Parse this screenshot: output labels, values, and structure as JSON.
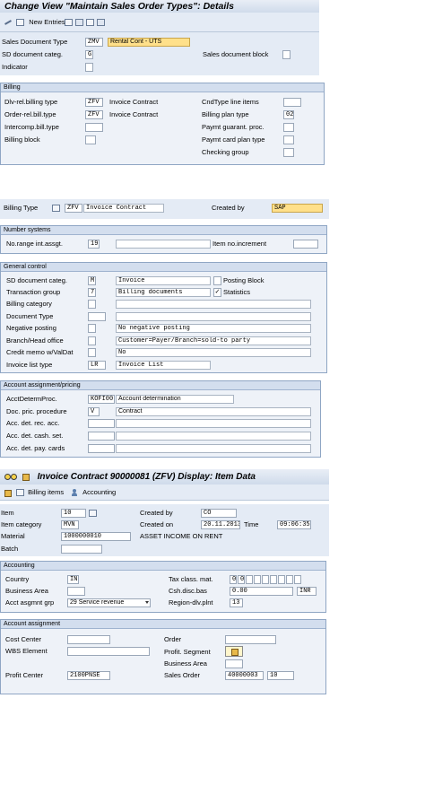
{
  "s1": {
    "title": "Change View \"Maintain Sales Order Types\": Details",
    "new_entries": "New Entries",
    "rows": [
      {
        "label": "Sales Document Type",
        "code": "ZMV",
        "desc": "Rental Cont - UTS"
      },
      {
        "label": "SD document categ.",
        "code": "G"
      },
      {
        "label": "Indicator"
      }
    ],
    "sales_doc_block_label": "Sales document block",
    "billing_title": "Billing",
    "billing_left": [
      {
        "label": "Dlv-rel.billing type",
        "code": "ZFV",
        "desc": "Invoice Contract"
      },
      {
        "label": "Order-rel.bill.type",
        "code": "ZFV",
        "desc": "Invoice Contract"
      },
      {
        "label": "Intercomp.bill.type"
      },
      {
        "label": "Billing block"
      }
    ],
    "billing_right": [
      {
        "label": "CndType line items",
        "value": ""
      },
      {
        "label": "Billing plan type",
        "value": "02"
      },
      {
        "label": "Paymt guarant. proc.",
        "value": ""
      },
      {
        "label": "Paymt card plan type",
        "value": ""
      },
      {
        "label": "Checking group",
        "value": ""
      }
    ]
  },
  "s2": {
    "billing_type_label": "Billing Type",
    "billing_type_code": "ZFV",
    "billing_type_desc": "Invoice Contract",
    "created_by_label": "Created by",
    "created_by_value": "SAP",
    "number_systems_title": "Number systems",
    "no_range_label": "No.range int.assgt.",
    "no_range_value": "19",
    "item_no_incr_label": "Item no.increment",
    "general_title": "General control",
    "general": [
      {
        "label": "SD document categ.",
        "code": "M",
        "desc": "Invoice"
      },
      {
        "label": "Transaction group",
        "code": "7",
        "desc": "Billing documents"
      },
      {
        "label": "Billing category",
        "code": "",
        "desc": ""
      },
      {
        "label": "Document Type",
        "code": "",
        "desc": ""
      },
      {
        "label": "Negative posting",
        "code": "",
        "desc": "No negative posting"
      },
      {
        "label": "Branch/Head office",
        "code": "",
        "desc": "Customer=Payer/Branch=sold-to party"
      },
      {
        "label": "Credit memo w/ValDat",
        "code": "",
        "desc": "No"
      },
      {
        "label": "Invoice list type",
        "code": "LR",
        "desc": "Invoice List"
      }
    ],
    "posting_block_label": "Posting Block",
    "statistics_label": "Statistics",
    "acct_title": "Account assignment/pricing",
    "acct": [
      {
        "label": "AcctDetermProc.",
        "code": "KOFI00",
        "desc": "Account determination"
      },
      {
        "label": "Doc. pric. procedure",
        "code": "V",
        "desc": "Contract"
      },
      {
        "label": "Acc. det. rec. acc.",
        "code": "",
        "desc": ""
      },
      {
        "label": "Acc. det. cash. set.",
        "code": "",
        "desc": ""
      },
      {
        "label": "Acc. det. pay. cards",
        "code": "",
        "desc": ""
      }
    ]
  },
  "s3": {
    "title": "Invoice Contract 90000081  (ZFV) Display: Item Data",
    "billing_items": "Billing items",
    "accounting": "Accounting",
    "item_label": "Item",
    "item_value": "10",
    "item_category_label": "Item category",
    "item_category_value": "MVN",
    "material_label": "Material",
    "material_value": "1000000010",
    "material_desc": "ASSET INCOME ON RENT",
    "batch_label": "Batch",
    "created_by_label": "Created by",
    "created_by_value": "CO",
    "created_on_label": "Created on",
    "created_on_value": "20.11.2013",
    "time_label": "Time",
    "time_value": "09:06:35",
    "accounting_title": "Accounting",
    "country_label": "Country",
    "country_value": "IN",
    "business_area_label": "Business Area",
    "acct_asgmt_label": "Acct asgmnt grp",
    "acct_asgmt_value": "29 Service revenue",
    "tax_class_label": "Tax class. mat.",
    "tax_class_values": [
      "0",
      "0",
      "",
      "",
      "",
      "",
      "",
      "",
      ""
    ],
    "csh_disc_label": "Csh.disc.bas",
    "csh_disc_value": "0.00",
    "currency": "INR",
    "region_label": "Region-dlv.plnt",
    "region_value": "13",
    "acct_assign_title": "Account assignment",
    "cost_center_label": "Cost Center",
    "wbs_label": "WBS Element",
    "profit_center_label": "Profit Center",
    "profit_center_value": "2100PNSE",
    "order_label": "Order",
    "profit_segment_label": "Profit. Segment",
    "business_area2_label": "Business Area",
    "sales_order_label": "Sales Order",
    "sales_order_value": "40000003",
    "sales_order_item": "10"
  }
}
